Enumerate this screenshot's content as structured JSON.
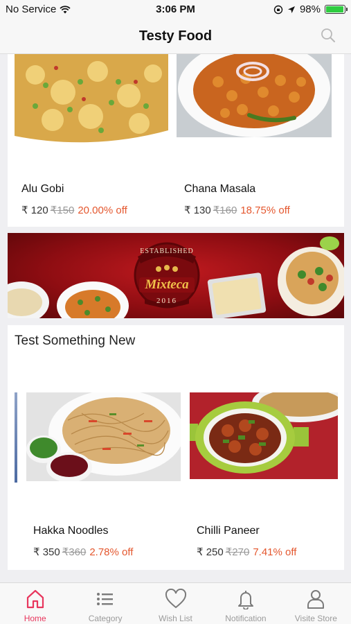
{
  "status_bar": {
    "carrier": "No Service",
    "time": "3:06 PM",
    "battery": "98%",
    "battery_level": 0.98
  },
  "header": {
    "title": "Testy Food"
  },
  "products_top": [
    {
      "name": "Alu Gobi",
      "price": "₹ 120",
      "original_price": "₹150",
      "discount": "20.00% off"
    },
    {
      "name": "Chana Masala",
      "price": "₹ 130",
      "original_price": "₹160",
      "discount": "18.75% off"
    }
  ],
  "banner": {
    "line1": "ESTABLISHED",
    "brand": "Mixteca",
    "year": "2016"
  },
  "section": {
    "title": "Test Something New"
  },
  "products_new": [
    {
      "name": "Hakka Noodles",
      "price": "₹ 350",
      "original_price": "₹360",
      "discount": "2.78% off"
    },
    {
      "name": "Chilli Paneer",
      "price": "₹ 250",
      "original_price": "₹270",
      "discount": "7.41% off"
    }
  ],
  "tabs": [
    {
      "label": "Home",
      "icon": "home-icon",
      "active": true
    },
    {
      "label": "Category",
      "icon": "list-icon",
      "active": false
    },
    {
      "label": "Wish List",
      "icon": "heart-icon",
      "active": false
    },
    {
      "label": "Notification",
      "icon": "bell-icon",
      "active": false
    },
    {
      "label": "Visite Store",
      "icon": "user-icon",
      "active": false
    }
  ],
  "colors": {
    "accent": "#e8365d",
    "discount": "#e4572e",
    "banner_red": "#9b1016"
  }
}
